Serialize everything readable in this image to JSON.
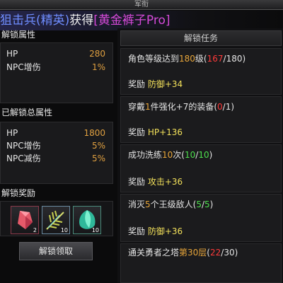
{
  "window": {
    "title": "军衔"
  },
  "header": {
    "unit": "狙击兵(精英)",
    "verb": "获得",
    "item": "[黄金裤子Pro]",
    "colors": {
      "unit": "#6f8dff",
      "item": "#d64ad9"
    }
  },
  "unlock_attrs": {
    "title": "解锁属性",
    "rows": [
      {
        "label": "HP",
        "value": "280"
      },
      {
        "label": "NPC增伤",
        "value": "1%"
      }
    ]
  },
  "total_attrs": {
    "title": "已解锁总属性",
    "rows": [
      {
        "label": "HP",
        "value": "1800"
      },
      {
        "label": "NPC增伤",
        "value": "5%"
      },
      {
        "label": "NPC减伤",
        "value": "5%"
      }
    ]
  },
  "rewards": {
    "title": "解锁奖励",
    "items": [
      {
        "icon": "red-crystal-icon",
        "count": "2"
      },
      {
        "icon": "golden-feather-icon",
        "count": "10"
      },
      {
        "icon": "green-gem-icon",
        "count": "10"
      }
    ],
    "claim_label": "解锁领取"
  },
  "tasks": {
    "title": "解锁任务",
    "list": [
      {
        "desc_pre": "角色等级达到",
        "desc_hl": "180",
        "desc_post": "级(",
        "progress_cur": "167",
        "progress_sep": "/",
        "progress_max": "180",
        "progress_close": ")",
        "reward_label": "奖励",
        "reward_value": "防御+34"
      },
      {
        "desc_pre": "穿戴",
        "desc_hl": "1",
        "desc_post": "件强化+7的装备(",
        "progress_cur": "0",
        "progress_sep": "/",
        "progress_max": "1",
        "progress_close": ")",
        "reward_label": "奖励",
        "reward_value": "HP+136"
      },
      {
        "desc_pre": "成功洗练",
        "desc_hl": "10",
        "desc_post": "次(",
        "progress_cur": "10",
        "progress_sep": "/",
        "progress_max": "10",
        "progress_close": ")",
        "reward_label": "奖励",
        "reward_value": "攻击+36"
      },
      {
        "desc_pre": "消灭",
        "desc_hl": "5",
        "desc_post": "个王级敌人(",
        "progress_cur": "5",
        "progress_sep": "/",
        "progress_max": "5",
        "progress_close": ")",
        "reward_label": "奖励",
        "reward_value": "防御+36"
      },
      {
        "desc_pre": "通关勇者之塔",
        "desc_hl": "第30层",
        "desc_post": "(",
        "progress_cur": "22",
        "progress_sep": "/",
        "progress_max": "30",
        "progress_close": ")"
      }
    ]
  }
}
